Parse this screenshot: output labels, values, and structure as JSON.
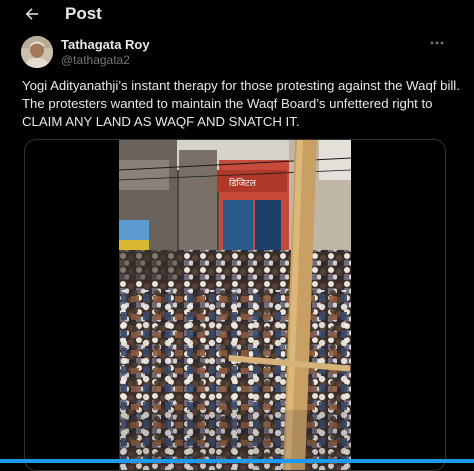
{
  "header": {
    "title": "Post",
    "back_icon": "arrow-left-icon"
  },
  "author": {
    "display_name": "Tathagata Roy",
    "handle": "@tathagata2",
    "avatar": "avatar-photo"
  },
  "tweet": {
    "text": "Yogi Adityanathji’s instant therapy for those protesting against the Waqf bill. The protesters wanted to maintain the Waqf Board’s unfettered right to CLAIM ANY LAND AS WAQF AND SNATCH IT."
  },
  "media": {
    "type": "video",
    "scene": "crowd-in-street",
    "sign_text": "डिजिटल"
  },
  "colors": {
    "background": "#000000",
    "text": "#e7e9ea",
    "muted": "#71767b",
    "border": "#2f3336",
    "accent": "#1d9bf0"
  }
}
